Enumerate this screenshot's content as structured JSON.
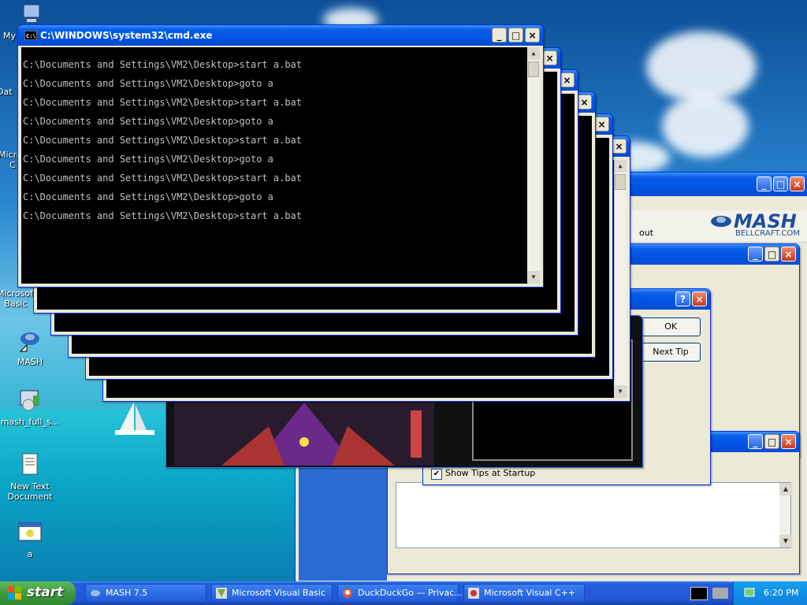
{
  "desktop": {
    "icons": [
      {
        "label": "My"
      },
      {
        "label": "Dat"
      },
      {
        "label": "Micro"
      },
      {
        "label": "C"
      },
      {
        "label": "Microsoft"
      },
      {
        "label": "Basic"
      },
      {
        "label": "MASH"
      },
      {
        "label": "mash_full_s..."
      },
      {
        "label": "New Text"
      },
      {
        "label": "Document"
      },
      {
        "label": "a"
      }
    ]
  },
  "cmd": {
    "title": "C:\\WINDOWS\\system32\\cmd.exe",
    "lines": [
      "C:\\Documents and Settings\\VM2\\Desktop>start a.bat",
      "C:\\Documents and Settings\\VM2\\Desktop>goto a",
      "C:\\Documents and Settings\\VM2\\Desktop>start a.bat",
      "C:\\Documents and Settings\\VM2\\Desktop>goto a",
      "C:\\Documents and Settings\\VM2\\Desktop>start a.bat",
      "C:\\Documents and Settings\\VM2\\Desktop>goto a",
      "C:\\Documents and Settings\\VM2\\Desktop>start a.bat",
      "C:\\Documents and Settings\\VM2\\Desktop>goto a",
      "C:\\Documents and Settings\\VM2\\Desktop>start a.bat"
    ]
  },
  "mash": {
    "logo": "MASH",
    "site": "BELLCRAFT.COM",
    "toolbar_partial": "out"
  },
  "tip_dialog": {
    "ok": "OK",
    "next_tip": "Next Tip",
    "show_tips": "Show Tips at Startup"
  },
  "taskbar": {
    "start": "start",
    "tasks": [
      {
        "label": "MASH 7.5"
      },
      {
        "label": "Microsoft Visual Basic"
      },
      {
        "label": "DuckDuckGo — Privac..."
      },
      {
        "label": "Microsoft Visual C++"
      }
    ],
    "clock": "6:20 PM"
  },
  "colors": {
    "titlebar": "#0054e3",
    "console_bg": "#000000",
    "taskbar": "#245edb"
  }
}
